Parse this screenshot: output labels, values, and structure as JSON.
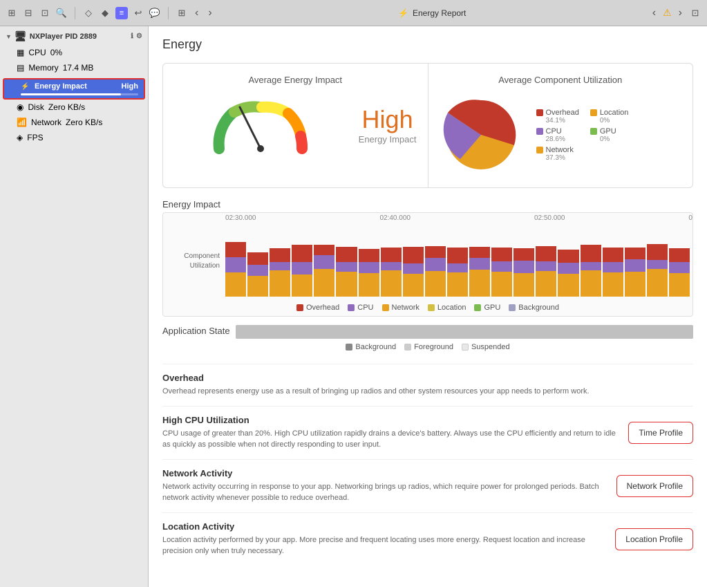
{
  "toolbar": {
    "title": "Energy Report",
    "warning": "⚠"
  },
  "sidebar": {
    "app_name": "NXPlayer PID 2889",
    "items": [
      {
        "id": "cpu",
        "label": "CPU",
        "value": "0%",
        "meter": 2
      },
      {
        "id": "memory",
        "label": "Memory",
        "value": "17.4 MB",
        "meter": 30
      },
      {
        "id": "energy",
        "label": "Energy Impact",
        "value": "High",
        "meter": 85,
        "active": true
      },
      {
        "id": "disk",
        "label": "Disk",
        "value": "Zero KB/s",
        "meter": 1
      },
      {
        "id": "network",
        "label": "Network",
        "value": "Zero KB/s",
        "meter": 1
      },
      {
        "id": "fps",
        "label": "FPS",
        "value": "",
        "meter": 0
      }
    ]
  },
  "content": {
    "title": "Energy",
    "avg_energy_title": "Average Energy Impact",
    "avg_component_title": "Average Component Utilization",
    "gauge_high": "High",
    "gauge_sub": "Energy Impact",
    "legend": [
      {
        "label": "Overhead",
        "value": "34.1%",
        "color": "#c0392b"
      },
      {
        "label": "Location",
        "value": "0%",
        "color": "#e8a020"
      },
      {
        "label": "CPU",
        "value": "28.6%",
        "color": "#8e6bbf"
      },
      {
        "label": "GPU",
        "value": "0%",
        "color": "#7bbb50"
      },
      {
        "label": "Network",
        "value": "37.3%",
        "color": "#e8a020"
      }
    ],
    "chart_title": "Energy Impact",
    "chart_y_label": "Component\nUtilization",
    "time_labels": [
      "02:30.000",
      "02:40.000",
      "02:50.000",
      "0"
    ],
    "bar_legend": [
      {
        "label": "Overhead",
        "color": "#c0392b"
      },
      {
        "label": "CPU",
        "color": "#8e6bbf"
      },
      {
        "label": "Network",
        "color": "#e8a020"
      },
      {
        "label": "Location",
        "color": "#d4a020"
      },
      {
        "label": "GPU",
        "color": "#7bbb50"
      },
      {
        "label": "Background",
        "color": "#a0a0c0"
      }
    ],
    "app_state_title": "Application State",
    "app_state_legend": [
      {
        "label": "Background",
        "color": "#888"
      },
      {
        "label": "Foreground",
        "color": "#ccc"
      },
      {
        "label": "Suspended",
        "color": "#e8e8e8"
      }
    ],
    "info_sections": [
      {
        "title": "Overhead",
        "desc": "Overhead represents energy use as a result of bringing up radios and other system resources your app needs to perform work.",
        "btn": null
      },
      {
        "title": "High CPU Utilization",
        "desc": "CPU usage of greater than 20%. High CPU utilization rapidly drains a device's battery. Always use the CPU efficiently and return to idle as quickly as possible when not directly responding to user input.",
        "btn": "Time Profile"
      },
      {
        "title": "Network Activity",
        "desc": "Network activity occurring in response to your app. Networking brings up radios, which require power for prolonged periods. Batch network activity whenever possible to reduce overhead.",
        "btn": "Network Profile"
      },
      {
        "title": "Location Activity",
        "desc": "Location activity performed by your app. More precise and frequent locating uses more energy. Request location and increase precision only when truly necessary.",
        "btn": "Location Profile"
      }
    ]
  }
}
